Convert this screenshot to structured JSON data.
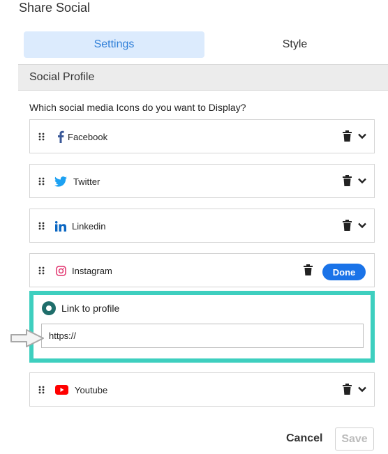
{
  "panel": {
    "title": "Share Social"
  },
  "tabs": [
    {
      "label": "Settings",
      "active": true
    },
    {
      "label": "Style",
      "active": false
    }
  ],
  "section": {
    "title": "Social Profile",
    "question": "Which social media Icons do you want to Display?"
  },
  "profiles": [
    {
      "label": "Facebook",
      "icon": "facebook-icon",
      "color": "#3b5998",
      "expanded": false
    },
    {
      "label": "Twitter",
      "icon": "twitter-icon",
      "color": "#1da1f2",
      "expanded": false
    },
    {
      "label": "Linkedin",
      "icon": "linkedin-icon",
      "color": "#0a66c2",
      "expanded": false
    },
    {
      "label": "Instagram",
      "icon": "instagram-icon",
      "color": "#e1306c",
      "expanded": true,
      "done_label": "Done"
    },
    {
      "label": "Youtube",
      "icon": "youtube-icon",
      "color": "#ff0000",
      "expanded": false
    }
  ],
  "link_editor": {
    "label": "Link to profile",
    "value": "https://"
  },
  "footer": {
    "cancel_label": "Cancel",
    "save_label": "Save"
  },
  "colors": {
    "accent": "#1a73e8",
    "highlight": "#3ecfbf",
    "tab_active_bg": "#dcebfd",
    "radio": "#1f6e6b"
  }
}
